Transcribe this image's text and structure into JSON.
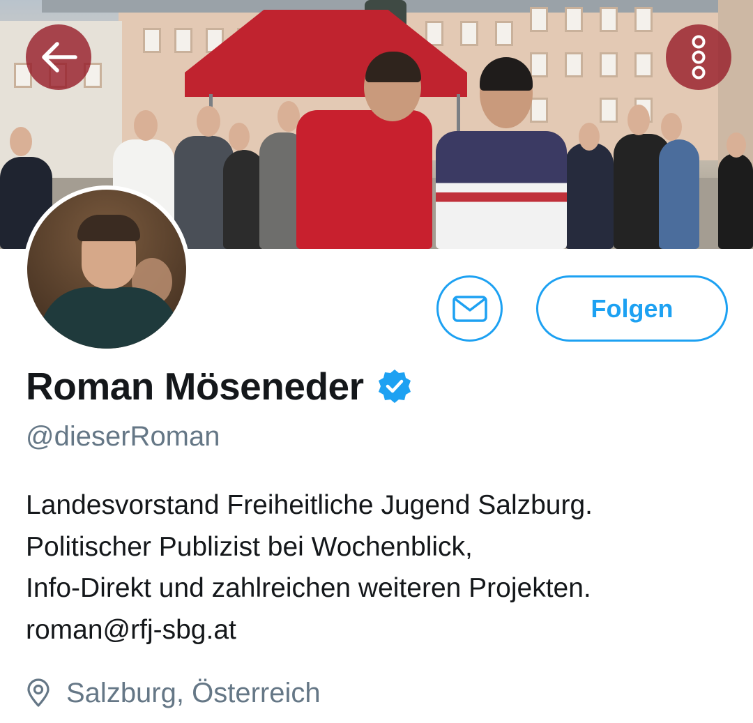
{
  "header": {
    "back_icon": "arrow-left-icon",
    "more_icon": "more-vertical-icon",
    "overlay_button_color": "#961c28"
  },
  "actions": {
    "message_icon": "envelope-icon",
    "follow_label": "Folgen",
    "accent_color": "#1da1f2"
  },
  "profile": {
    "display_name": "Roman Möseneder",
    "verified_icon": "verified-badge-icon",
    "handle": "@dieserRoman",
    "bio_lines": [
      "Landesvorstand Freiheitliche Jugend Salzburg.",
      "Politischer Publizist bei Wochenblick,",
      "Info-Direkt und zahlreichen weiteren Projekten.",
      "roman@rfj-sbg.at"
    ],
    "location_icon": "location-pin-icon",
    "location": "Salzburg, Österreich"
  }
}
